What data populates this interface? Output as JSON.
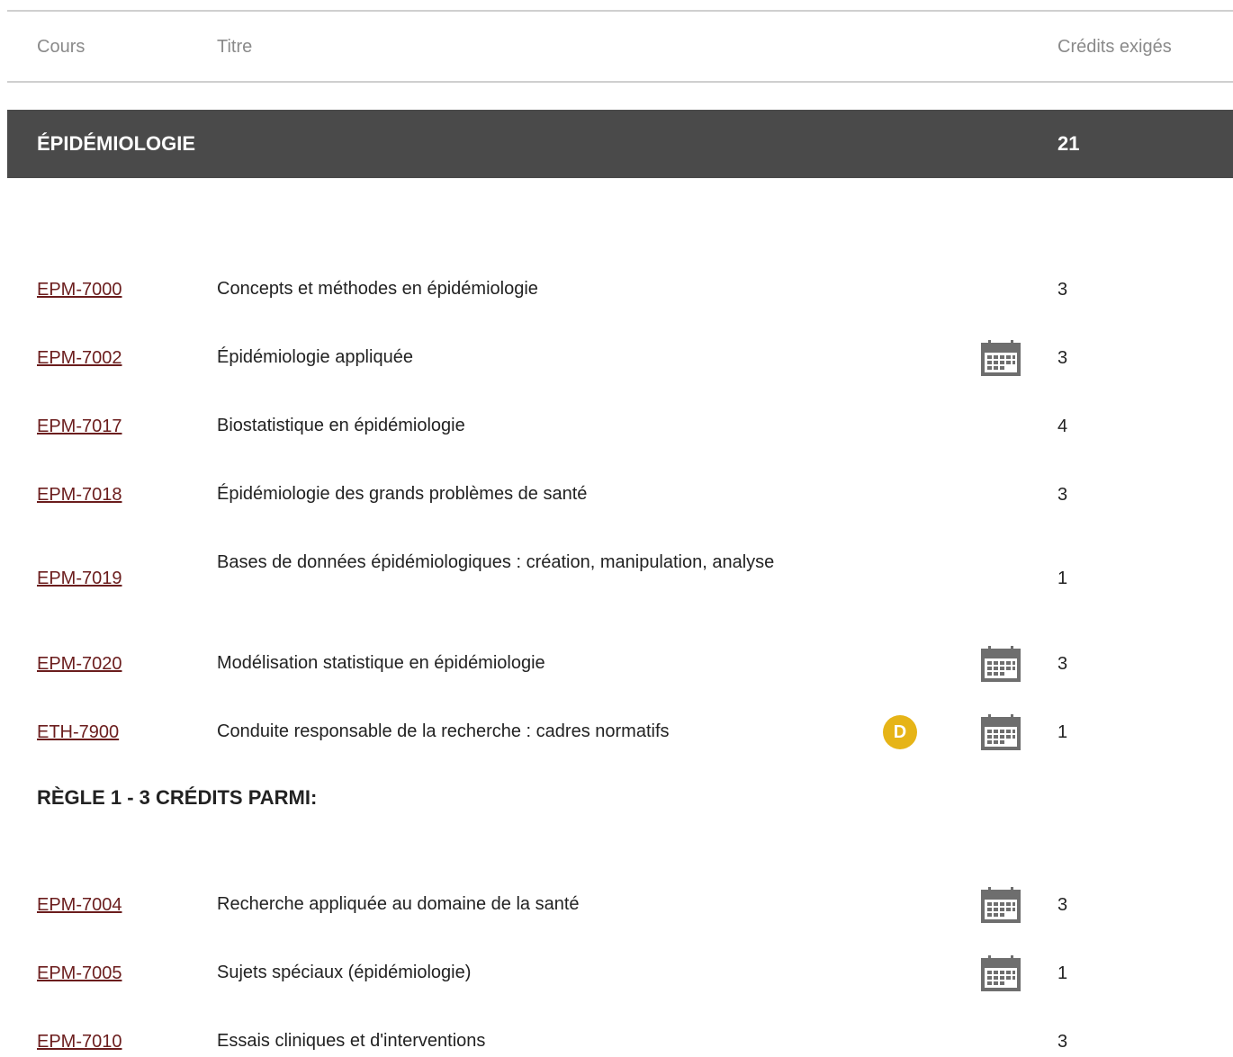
{
  "table_header": {
    "course": "Cours",
    "title": "Titre",
    "credits": "Crédits exigés"
  },
  "section": {
    "title": "ÉPIDÉMIOLOGIE",
    "credits": "21"
  },
  "courses": [
    {
      "code": "EPM-7000",
      "title": "Concepts et méthodes en épidémiologie",
      "credits": "3",
      "calendar": false,
      "badge": ""
    },
    {
      "code": "EPM-7002",
      "title": "Épidémiologie appliquée",
      "credits": "3",
      "calendar": true,
      "badge": ""
    },
    {
      "code": "EPM-7017",
      "title": "Biostatistique en épidémiologie",
      "credits": "4",
      "calendar": false,
      "badge": ""
    },
    {
      "code": "EPM-7018",
      "title": "Épidémiologie des grands problèmes de santé",
      "credits": "3",
      "calendar": false,
      "badge": ""
    },
    {
      "code": "EPM-7019",
      "title": "Bases de données épidémiologiques : création, manipulation, analyse",
      "credits": "1",
      "calendar": false,
      "badge": ""
    },
    {
      "code": "EPM-7020",
      "title": "Modélisation statistique en épidémiologie",
      "credits": "3",
      "calendar": true,
      "badge": ""
    },
    {
      "code": "ETH-7900",
      "title": "Conduite responsable de la recherche : cadres normatifs",
      "credits": "1",
      "calendar": true,
      "badge": "D"
    }
  ],
  "rule": {
    "title": "RÈGLE 1 - 3 CRÉDITS PARMI:"
  },
  "rule_courses": [
    {
      "code": "EPM-7004",
      "title": "Recherche appliquée au domaine de la santé",
      "credits": "3",
      "calendar": true
    },
    {
      "code": "EPM-7005",
      "title": "Sujets spéciaux (épidémiologie)",
      "credits": "1",
      "calendar": true
    },
    {
      "code": "EPM-7010",
      "title": "Essais cliniques et d'interventions",
      "credits": "3",
      "calendar": false
    }
  ],
  "icons": {
    "calendar": "calendar-icon",
    "badge_color": "#e6b417",
    "link_color": "#6b1d1d",
    "section_bg": "#4a4a4a"
  }
}
